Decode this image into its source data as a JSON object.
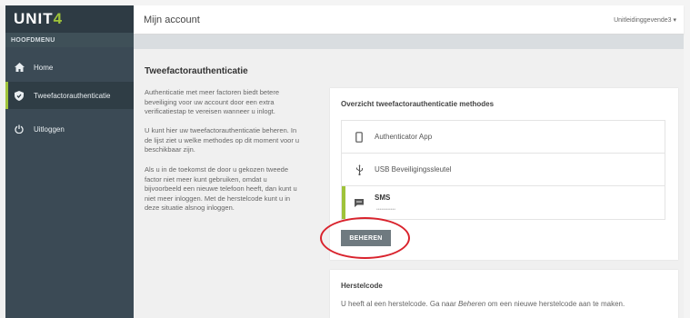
{
  "app": {
    "logo_text": "UNIT",
    "logo_accent": "4",
    "accent_color": "#9fc33a",
    "sidebar_color": "#3b4a55"
  },
  "sidebar": {
    "heading": "HOOFDMENU",
    "items": [
      {
        "label": "Home",
        "icon": "home-icon"
      },
      {
        "label": "Tweefactorauthenticatie",
        "icon": "shield-icon",
        "active": true
      },
      {
        "label": "Uitloggen",
        "icon": "power-icon"
      }
    ]
  },
  "header": {
    "title": "Mijn account",
    "user": "Unitleidinggevende3"
  },
  "intro": {
    "title": "Tweefactorauthenticatie",
    "paragraphs": [
      "Authenticatie met meer factoren biedt betere beveiliging voor uw account door een extra verificatiestap te vereisen wanneer u inlogt.",
      "U kunt hier uw tweefactorauthenticatie beheren. In de lijst ziet u welke methodes op dit moment voor u beschikbaar zijn.",
      "Als u in de toekomst de door u gekozen tweede factor niet meer kunt gebruiken, omdat u bijvoorbeeld een nieuwe telefoon heeft, dan kunt u niet meer inloggen. Met de herstelcode kunt u in deze situatie alsnog inloggen."
    ]
  },
  "overview": {
    "title": "Overzicht tweefactorauthenticatie methodes",
    "methods": [
      {
        "label": "Authenticator App",
        "icon": "phone-icon"
      },
      {
        "label": "USB Beveiligingssleutel",
        "icon": "usb-icon"
      },
      {
        "label": "SMS",
        "icon": "sms-icon",
        "active": true,
        "sub": "••••••••••••"
      }
    ],
    "button_label": "BEHEREN"
  },
  "recovery": {
    "title": "Herstelcode",
    "text_before": "U heeft al een herstelcode. Ga naar ",
    "text_em": "Beheren",
    "text_after": " om een nieuwe herstelcode aan te maken."
  }
}
